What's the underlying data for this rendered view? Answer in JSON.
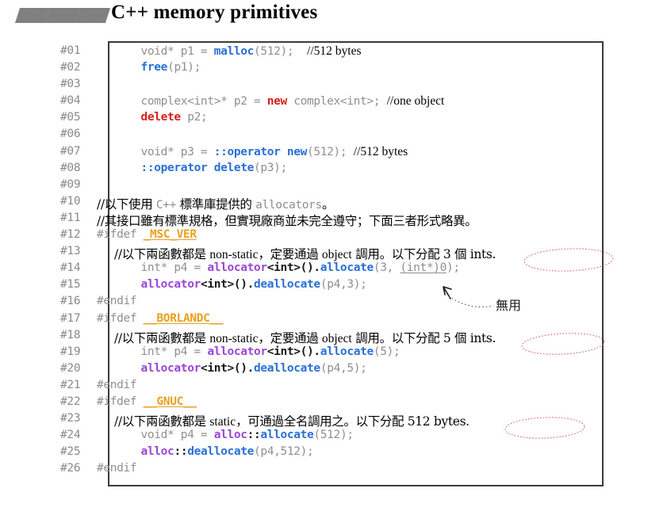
{
  "slide": {
    "title": "C++ memory primitives",
    "bullet_marks": 3
  },
  "colors": {
    "title_text": "#000000",
    "bullet_mark": "#808080",
    "code_default": "#8f8f8f",
    "lineno": "#8a8a8a",
    "token_blue": "#2a6fd6",
    "token_red": "#d62020",
    "token_purple": "#9b46d6",
    "token_orange": "#e8a020",
    "token_black": "#1a1a1a",
    "comment_text": "#000000",
    "annotation_red": "#d06a6a",
    "box_border": "#3a3a3a",
    "background": "#ffffff"
  },
  "code": {
    "language": "cpp",
    "line_numbers": [
      "#01",
      "#02",
      "#03",
      "#04",
      "#05",
      "#06",
      "#07",
      "#08",
      "#09",
      "#10",
      "#11",
      "#12",
      "#13",
      "#14",
      "#15",
      "#16",
      "#17",
      "#18",
      "#19",
      "#20",
      "#21",
      "#22",
      "#23",
      "#24",
      "#25",
      "#26"
    ],
    "lines": [
      "    void* p1 = malloc(512);  //512 bytes",
      "    free(p1);",
      "",
      "    complex<int>* p2 = new complex<int>; //one object",
      "    delete p2;",
      "",
      "    void* p3 = ::operator new(512); //512 bytes",
      "    ::operator delete(p3);",
      "",
      "//以下使用 C++ 標準庫提供的 allocators。",
      "//其接口雖有標準規格，但實現廠商並未完全遵守；下面三者形式略異。",
      "#ifdef _MSC_VER",
      "    //以下兩函數都是 non-static，定要通過 object 調用。以下分配 3 個 ints.",
      "    int* p4 = allocator<int>().allocate(3, (int*)0);",
      "    allocator<int>().deallocate(p4,3);",
      "#endif",
      "#ifdef __BORLANDC__",
      "    //以下兩函數都是 non-static，定要通過 object 調用。以下分配 5 個 ints.",
      "    int* p4 = allocator<int>().allocate(5);",
      "    allocator<int>().deallocate(p4,5);",
      "#endif",
      "#ifdef __GNUC__",
      "    //以下兩函數都是 static，可通過全名調用之。以下分配 512 bytes.",
      "    void* p4 = alloc::allocate(512);",
      "    alloc::deallocate(p4,512);",
      "#endif"
    ],
    "tokens": {
      "malloc": "malloc",
      "free": "free",
      "new": "new",
      "delete": "delete",
      "operator_new": "::operator new",
      "operator_delete": "::operator delete",
      "allocator": "allocator",
      "alloc": "alloc",
      "allocate": "allocate",
      "deallocate": "deallocate",
      "msc_ver": "_MSC_VER",
      "borlandc": "__BORLANDC__",
      "gnuc": "__GNUC__",
      "ifdef": "#ifdef",
      "endif": "#endif"
    },
    "comments": {
      "c01": "//512 bytes",
      "c04": "//one object",
      "c07": "//512 bytes",
      "c10_a": "//以下使用 ",
      "c10_b": "C++",
      "c10_c": " 標準庫提供的 ",
      "c10_d": "allocators",
      "c10_e": "。",
      "c11": "//其接口雖有標準規格，但實現廠商並未完全遵守；下面三者形式略異。",
      "c13_a": "//以下兩函數都是 ",
      "c13_b": "non-static",
      "c13_c": "，定要通過 ",
      "c13_d": "object",
      "c13_e": " 調用。以下分配 3 個 ints.",
      "c18_e": " 調用。以下分配 5 個 ints.",
      "c23_a": "//以下兩函數都是 ",
      "c23_b": "static",
      "c23_c": "，可通過全名調用之。以下分配 512 bytes."
    }
  },
  "annotations": {
    "ellipse_line13_label": "3 個 ints.",
    "ellipse_line18_label": "5 個 ints.",
    "ellipse_line23_label": "512 bytes.",
    "underline_line14": "(int*)0",
    "arrow_note": "無用"
  }
}
